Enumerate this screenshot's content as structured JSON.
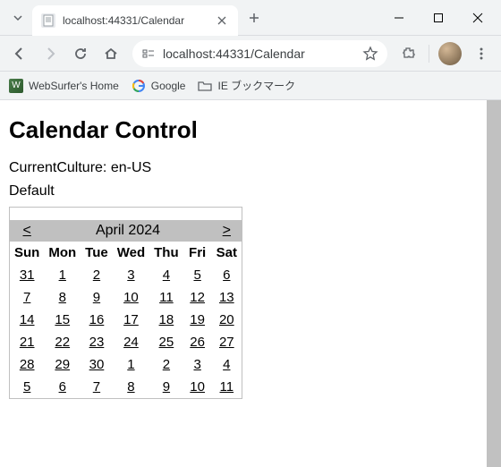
{
  "browser": {
    "tab_title": "localhost:44331/Calendar",
    "url": "localhost:44331/Calendar",
    "bookmarks": [
      {
        "label": "WebSurfer's Home"
      },
      {
        "label": "Google"
      },
      {
        "label": "IE ブックマーク"
      }
    ]
  },
  "page": {
    "heading": "Calendar Control",
    "culture_line": "CurrentCulture: en-US",
    "default_label": "Default"
  },
  "calendar": {
    "prev": "<",
    "next": ">",
    "title": "April 2024",
    "day_headers": [
      "Sun",
      "Mon",
      "Tue",
      "Wed",
      "Thu",
      "Fri",
      "Sat"
    ],
    "weeks": [
      [
        "31",
        "1",
        "2",
        "3",
        "4",
        "5",
        "6"
      ],
      [
        "7",
        "8",
        "9",
        "10",
        "11",
        "12",
        "13"
      ],
      [
        "14",
        "15",
        "16",
        "17",
        "18",
        "19",
        "20"
      ],
      [
        "21",
        "22",
        "23",
        "24",
        "25",
        "26",
        "27"
      ],
      [
        "28",
        "29",
        "30",
        "1",
        "2",
        "3",
        "4"
      ],
      [
        "5",
        "6",
        "7",
        "8",
        "9",
        "10",
        "11"
      ]
    ]
  }
}
